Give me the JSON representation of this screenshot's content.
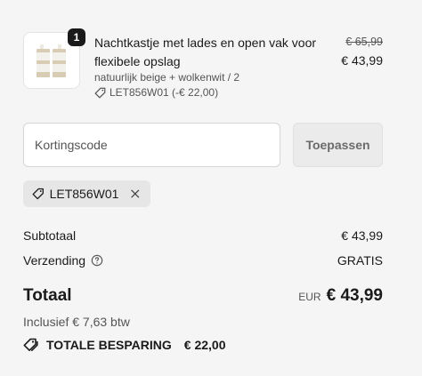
{
  "product": {
    "quantity": "1",
    "title": "Nachtkastje met lades en open vak voor flexibele opslag",
    "variant": "natuurlijk beige + wolkenwit / 2",
    "discount": "LET856W01 (-€ 22,00)",
    "price_original": "€ 65,99",
    "price_current": "€ 43,99"
  },
  "discount_form": {
    "placeholder": "Kortingscode",
    "apply_label": "Toepassen",
    "applied_code": "LET856W01"
  },
  "summary": {
    "subtotal_label": "Subtotaal",
    "subtotal_value": "€ 43,99",
    "shipping_label": "Verzending",
    "shipping_value": "GRATIS",
    "total_label": "Totaal",
    "currency": "EUR",
    "total_value": "€ 43,99",
    "vat_text": "Inclusief € 7,63 btw",
    "savings_label": "TOTALE BESPARING",
    "savings_value": "€ 22,00"
  },
  "icons": {
    "tag": "tag-icon",
    "close": "close-icon",
    "help": "help-circle-icon",
    "savings": "tags-icon"
  }
}
